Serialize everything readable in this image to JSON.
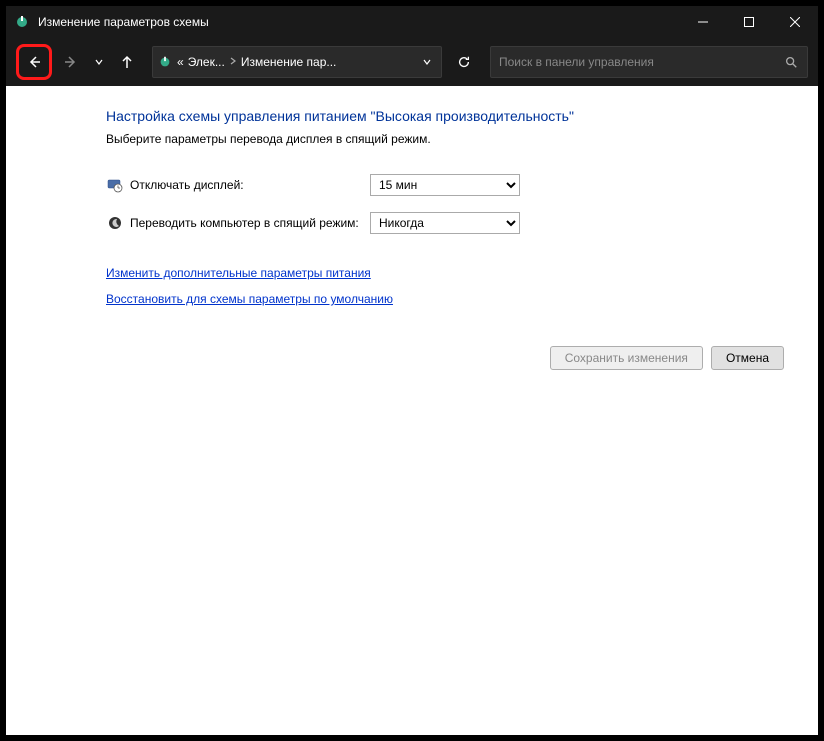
{
  "window": {
    "title": "Изменение параметров схемы"
  },
  "breadcrumb": {
    "overflow": "«",
    "item1": "Элек...",
    "item2": "Изменение пар..."
  },
  "search": {
    "placeholder": "Поиск в панели управления"
  },
  "content": {
    "heading": "Настройка схемы управления питанием \"Высокая производительность\"",
    "subheading": "Выберите параметры перевода дисплея в спящий режим.",
    "display_off_label": "Отключать дисплей:",
    "display_off_value": "15 мин",
    "sleep_label": "Переводить компьютер в спящий режим:",
    "sleep_value": "Никогда",
    "link_advanced": "Изменить дополнительные параметры питания",
    "link_restore": "Восстановить для схемы параметры по умолчанию"
  },
  "buttons": {
    "save": "Сохранить изменения",
    "cancel": "Отмена"
  }
}
